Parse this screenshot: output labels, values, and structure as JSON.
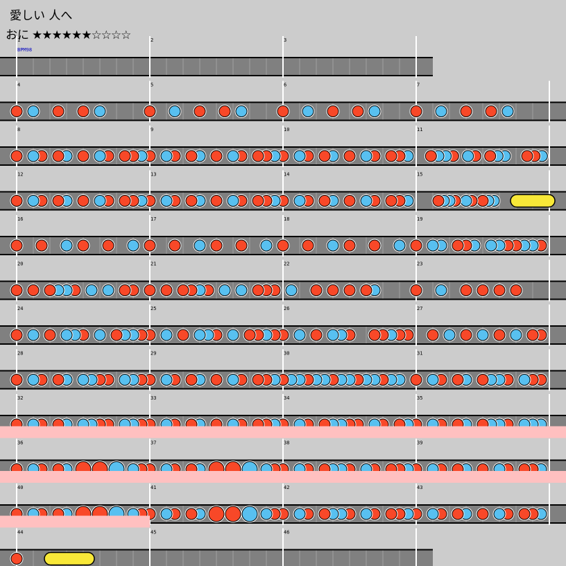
{
  "title": "愛しい 人へ",
  "course": {
    "name": "おに",
    "stars": "★★★★★★☆☆☆☆"
  },
  "bpm_label": "BPM98",
  "colors": {
    "background": "#cccccc",
    "lane": "#808080",
    "lane_border": "#000000",
    "beat_line": "#a0a0a0",
    "barline": "#ffffff",
    "don": "#f84828",
    "ka": "#58c0f0",
    "roll": "#f8e838",
    "gogo_band": "#ffc0c0",
    "bpm_text": "#0000c0"
  },
  "note_legend": {
    "d": "don (red)",
    "k": "ka (blue)",
    "D": "big don",
    "K": "big ka",
    "R": "drumroll start",
    "E": "drumroll end"
  },
  "rows": [
    {
      "measures": [
        1,
        2,
        3
      ],
      "gogo": false,
      "notes": [
        "................",
        "................",
        "................"
      ]
    },
    {
      "measures": [
        4,
        5,
        6,
        7
      ],
      "gogo": false,
      "notes": [
        "d.k..d..d.k.....",
        "d..k..d..d.k....",
        "d..k..d..d.k....",
        "d..k..d..d.k...."
      ]
    },
    {
      "measures": [
        8,
        9,
        10,
        11
      ],
      "gogo": false,
      "notes": [
        "d.kd.dk.d.kd.ddk",
        "d.kd.dk.d.kd.ddk",
        "d.kd.dk.d.kd.ddk",
        "..dkkd.kd.dkk..ddk"
      ]
    },
    {
      "measures": [
        12,
        13,
        14,
        15
      ],
      "gogo": false,
      "notes": [
        "d.kd.dk.d.kd.ddk",
        "d.kd.dk.d.kd.ddk",
        "d.kd.dk.d.kd.ddk",
        "....dkkd.kd.dkkR.......E"
      ]
    },
    {
      "measures": [
        16,
        17,
        18,
        19
      ],
      "gogo": false,
      "notes": [
        "d..d..k.d..d..k.",
        "d..d..k.d..d..k.",
        "d..d..k.d..d..k.",
        "d.kk.ddk.kkddkkd"
      ]
    },
    {
      "measures": [
        20,
        21,
        22,
        23
      ],
      "gogo": false,
      "notes": [
        "d.d.dkkd.k.k.dd.",
        "d.d.ddkd.k.k.ddd",
        ".k..d.d.d.dk....",
        "d..k..d.d.d.d..."
      ]
    },
    {
      "measures": [
        24,
        25,
        26,
        27
      ],
      "gogo": false,
      "notes": [
        "d.k.d.kkd.k.dkkd",
        "d.k.d.kkd.k.ddkd",
        "d.k.d.kkd..ddkdd",
        "..d.k.d.k.d.k.dd"
      ]
    },
    {
      "measures": [
        28,
        29,
        30,
        31
      ],
      "gogo": false,
      "notes": [
        "d.kd.dk.kkdd.kkd",
        "d.kd.dk.d.kd.ddk",
        "dkkdkkdkkdkkdkk.",
        "d.kd.dk.dkkd.kdd"
      ]
    },
    {
      "measures": [
        32,
        33,
        34,
        35
      ],
      "gogo": false,
      "notes": [
        "d.kd.dk.kkdd.kkd",
        "d.kd.dk.d.kd.ddk",
        "d.kd.dkkdd.kd.dk",
        "d.kd.dk.dkkd.kkk"
      ]
    },
    {
      "measures": [
        36,
        37,
        38,
        39
      ],
      "gogo": true,
      "notes": [
        "d.kd.dk.D.D.K.kd",
        "d.kd.dk.D.D.K.kd",
        "d.kd.dkkd.kd.ddk",
        "d.kd.dk.d.kd.ddk"
      ]
    },
    {
      "measures": [
        40,
        41,
        42,
        43
      ],
      "gogo": true,
      "notes": [
        "d.kd.dk.D.D.K.kd",
        "d.kd.dk.D.D.K.kd",
        "d.kd.dkkd.kd.ddk",
        "d.kd.dk.d.kd.ddk"
      ]
    },
    {
      "measures": [
        44,
        45,
        46
      ],
      "gogo": true,
      "notes": [
        "d.R.....E.......",
        "................",
        "................"
      ]
    }
  ]
}
